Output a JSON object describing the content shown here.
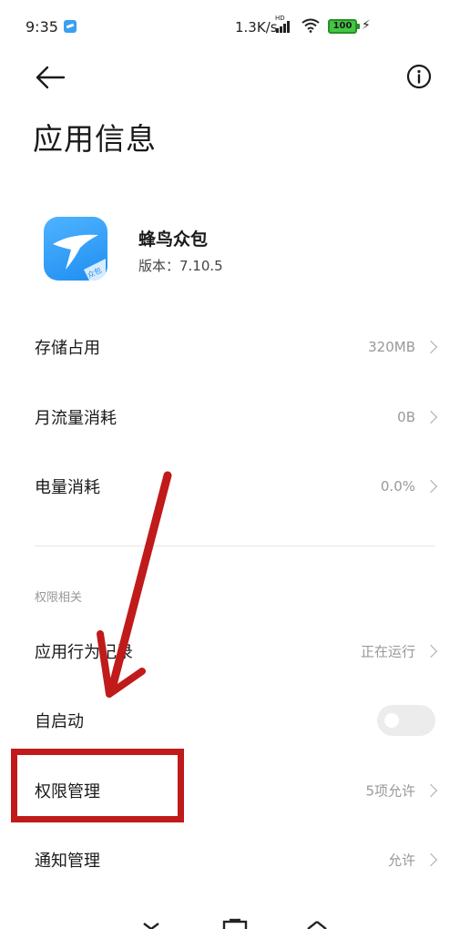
{
  "status_bar": {
    "time": "9:35",
    "network_speed": "1.3K/s",
    "hd": "HD",
    "battery": "100"
  },
  "header": {
    "title": "应用信息"
  },
  "app": {
    "name": "蜂鸟众包",
    "version": "版本：7.10.5",
    "icon_badge": "众包"
  },
  "rows": {
    "storage": {
      "label": "存储占用",
      "value": "320MB"
    },
    "data_usage": {
      "label": "月流量消耗",
      "value": "0B"
    },
    "battery": {
      "label": "电量消耗",
      "value": "0.0%"
    }
  },
  "permissions_section": {
    "label": "权限相关",
    "rows": {
      "behavior": {
        "label": "应用行为记录",
        "value": "正在运行"
      },
      "autostart": {
        "label": "自启动",
        "enabled": false
      },
      "permission_mgmt": {
        "label": "权限管理",
        "value": "5项允许"
      },
      "notification": {
        "label": "通知管理",
        "value": "允许"
      }
    }
  },
  "annotation": {
    "color": "#c01a1a"
  },
  "icons": [
    "back-arrow-icon",
    "info-icon",
    "chevron-right-icon",
    "wifi-icon",
    "signal-icon",
    "battery-icon",
    "charging-icon"
  ]
}
